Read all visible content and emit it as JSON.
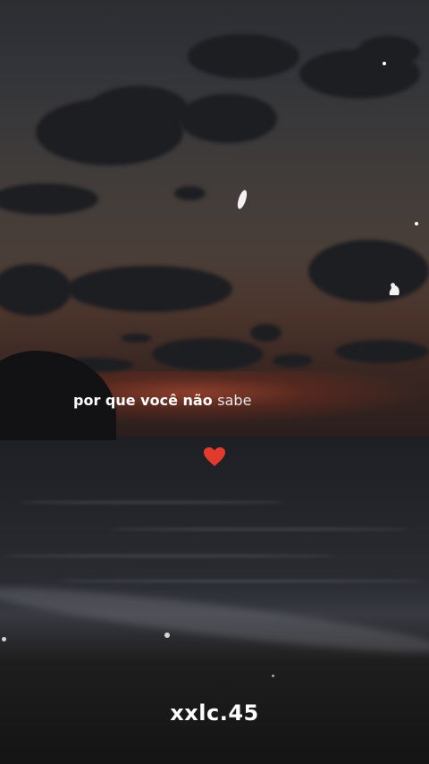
{
  "caption": {
    "prefix": "por que você não",
    "highlight": "sabe"
  },
  "heart_icon": "red-heart-emoji",
  "watermark": "xxlc.45",
  "colors": {
    "caption_text": "#ffffff",
    "heart": "#e23b2e",
    "sunset_glow": "#aa462d"
  }
}
